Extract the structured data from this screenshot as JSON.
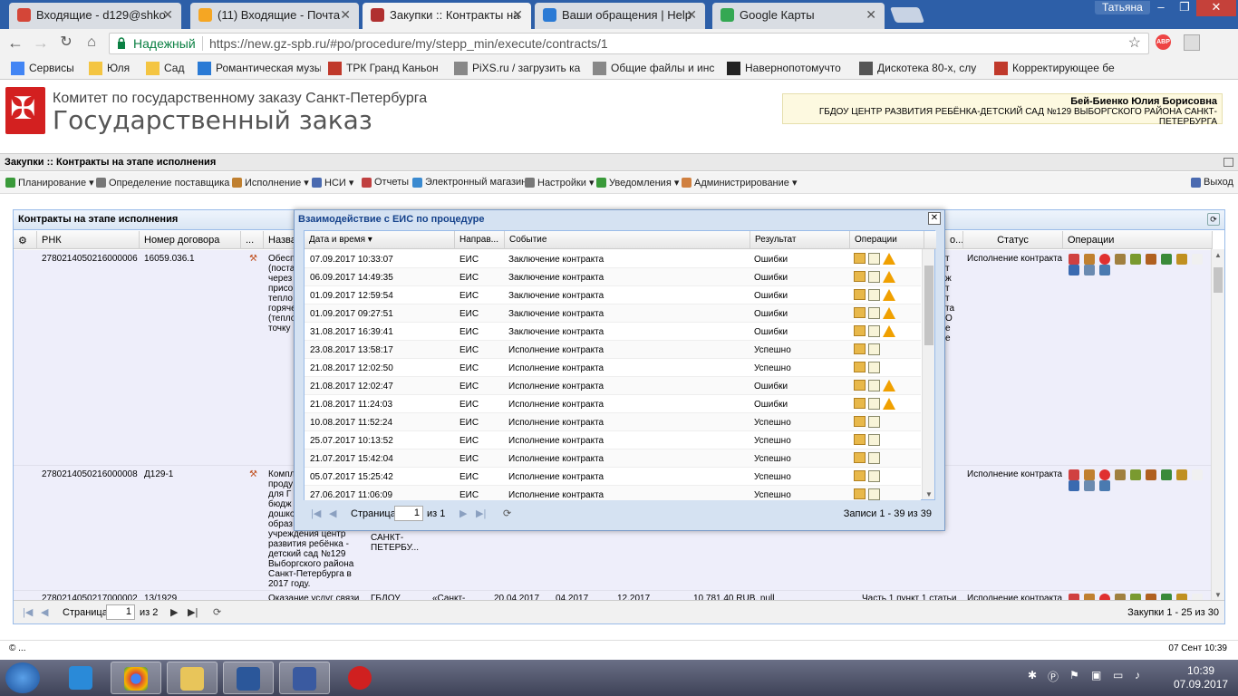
{
  "browser": {
    "tabs": [
      {
        "title": "Входящие - d129@shko",
        "icon_color": "#d44638"
      },
      {
        "title": "(11) Входящие - Почта",
        "icon_color": "#f5a623"
      },
      {
        "title": "Закупки :: Контракты на",
        "icon_color": "#b03030"
      },
      {
        "title": "Ваши обращения | Help",
        "icon_color": "#2a7ad5"
      },
      {
        "title": "Google Карты",
        "icon_color": "#34a853"
      }
    ],
    "user_label": "Татьяна",
    "secure_label": "Надежный",
    "url": "https://new.gz-spb.ru/#po/procedure/my/stepp_min/execute/contracts/1",
    "abp_label": "ABP",
    "bookmarks": [
      {
        "label": "Сервисы",
        "icon_color": "#4285f4"
      },
      {
        "label": "Юля",
        "icon_color": "#f4c542"
      },
      {
        "label": "Сад",
        "icon_color": "#f4c542"
      },
      {
        "label": "Романтическая музы",
        "icon_color": "#2a7ad5"
      },
      {
        "label": "ТРК Гранд Каньон",
        "icon_color": "#c0392b"
      },
      {
        "label": "PiXS.ru / загрузить ка",
        "icon_color": "#888888"
      },
      {
        "label": "Общие файлы и инс",
        "icon_color": "#888888"
      },
      {
        "label": "Навернопотомучто",
        "icon_color": "#222222"
      },
      {
        "label": "Дискотека 80-х, слу",
        "icon_color": "#555555"
      },
      {
        "label": "Корректирующее бе",
        "icon_color": "#c0392b"
      }
    ]
  },
  "site": {
    "org_name": "Комитет по государственному заказу Санкт-Петербурга",
    "title": "Государственный заказ",
    "user_name": "Бей-Биенко Юлия Борисовна",
    "user_org": "ГБДОУ ЦЕНТР РАЗВИТИЯ РЕБЁНКА-ДЕТСКИЙ САД №129 ВЫБОРГСКОГО РАЙОНА САНКТ-ПЕТЕРБУРГА",
    "page_title": "Закупки :: Контракты на этапе исполнения",
    "menu": [
      {
        "label": "Планирование",
        "icon_color": "#3a9a3a"
      },
      {
        "label": "Определение поставщика",
        "icon_color": "#777777"
      },
      {
        "label": "Исполнение",
        "icon_color": "#c08030"
      },
      {
        "label": "НСИ",
        "icon_color": "#4a6ab0"
      },
      {
        "label": "Отчеты",
        "icon_color": "#c04040"
      },
      {
        "label": "Электронный магазин",
        "icon_color": "#3a8ad0"
      },
      {
        "label": "Настройки",
        "icon_color": "#777777"
      },
      {
        "label": "Уведомления",
        "icon_color": "#3a9a3a"
      },
      {
        "label": "Администрирование",
        "icon_color": "#d08040"
      }
    ],
    "exit_label": "Выход"
  },
  "grid": {
    "title": "Контракты на этапе исполнения",
    "columns": [
      "РНК",
      "Номер договора",
      "...",
      "Назва",
      "о...",
      "Статус",
      "Операции"
    ],
    "rows": [
      {
        "rnk": "2780214050216000006",
        "number": "16059.036.1",
        "name_lines": [
          "Обесп",
          "(поста",
          "через",
          "присо",
          "тепло",
          "горяче",
          "(тепло",
          "точку"
        ],
        "side_fragments": [
          "т",
          "т",
          "ж",
          "т",
          "т",
          "та",
          "О",
          "е",
          "е"
        ],
        "status": "Исполнение контракта"
      },
      {
        "rnk": "2780214050216000008",
        "number": "Д129-1",
        "name_lines": [
          "Компл",
          "проду",
          "для Г",
          "бюдж",
          "дошко",
          "образ",
          "учреждения центр",
          "развития ребёнка -",
          "детский сад №129",
          "Выборгского района",
          "Санкт-Петербурга в",
          "2017 году."
        ],
        "cust_lines": [
          "ВЫБОРГС...",
          "РАЙОНА",
          "САНКТ-",
          "ПЕТЕРБУ..."
        ],
        "status": "Исполнение контракта"
      },
      {
        "rnk": "2780214050217000002",
        "number": "13/1929",
        "name": "Оказание услуг связи",
        "cust": "ГБДОУ",
        "extra": [
          "«Санкт-",
          "20.04.2017",
          "04.2017",
          "12.2017",
          "10 781,40 RUB, null",
          "Часть 1 пункт 1 статьи"
        ],
        "status": "Исполнение контракта"
      }
    ],
    "pager": {
      "page_label": "Страница",
      "page": "1",
      "of": "из 2",
      "summary": "Закупки 1 - 25 из 30"
    }
  },
  "modal": {
    "title": "Взаимодействие с ЕИС по процедуре",
    "columns": [
      "Дата и время",
      "Направ...",
      "Событие",
      "Результат",
      "Операции"
    ],
    "rows": [
      {
        "date": "07.09.2017 10:33:07",
        "dir": "ЕИС",
        "event": "Заключение контракта",
        "result": "Ошибки",
        "warn": true
      },
      {
        "date": "06.09.2017 14:49:35",
        "dir": "ЕИС",
        "event": "Заключение контракта",
        "result": "Ошибки",
        "warn": true
      },
      {
        "date": "01.09.2017 12:59:54",
        "dir": "ЕИС",
        "event": "Заключение контракта",
        "result": "Ошибки",
        "warn": true
      },
      {
        "date": "01.09.2017 09:27:51",
        "dir": "ЕИС",
        "event": "Заключение контракта",
        "result": "Ошибки",
        "warn": true
      },
      {
        "date": "31.08.2017 16:39:41",
        "dir": "ЕИС",
        "event": "Заключение контракта",
        "result": "Ошибки",
        "warn": true
      },
      {
        "date": "23.08.2017 13:58:17",
        "dir": "ЕИС",
        "event": "Исполнение контракта",
        "result": "Успешно",
        "warn": false
      },
      {
        "date": "21.08.2017 12:02:50",
        "dir": "ЕИС",
        "event": "Исполнение контракта",
        "result": "Успешно",
        "warn": false
      },
      {
        "date": "21.08.2017 12:02:47",
        "dir": "ЕИС",
        "event": "Исполнение контракта",
        "result": "Ошибки",
        "warn": true
      },
      {
        "date": "21.08.2017 11:24:03",
        "dir": "ЕИС",
        "event": "Исполнение контракта",
        "result": "Ошибки",
        "warn": true
      },
      {
        "date": "10.08.2017 11:52:24",
        "dir": "ЕИС",
        "event": "Исполнение контракта",
        "result": "Успешно",
        "warn": false
      },
      {
        "date": "25.07.2017 10:13:52",
        "dir": "ЕИС",
        "event": "Исполнение контракта",
        "result": "Успешно",
        "warn": false
      },
      {
        "date": "21.07.2017 15:42:04",
        "dir": "ЕИС",
        "event": "Исполнение контракта",
        "result": "Успешно",
        "warn": false
      },
      {
        "date": "05.07.2017 15:25:42",
        "dir": "ЕИС",
        "event": "Исполнение контракта",
        "result": "Успешно",
        "warn": false
      },
      {
        "date": "27.06.2017 11:06:09",
        "dir": "ЕИС",
        "event": "Исполнение контракта",
        "result": "Успешно",
        "warn": false
      }
    ],
    "pager": {
      "page_label": "Страница",
      "page": "1",
      "of": "из 1",
      "summary": "Записи 1 - 39 из 39"
    }
  },
  "status": {
    "left": "© ...",
    "right": "07 Сент 10:39"
  },
  "taskbar": {
    "time": "10:39",
    "date": "07.09.2017"
  }
}
